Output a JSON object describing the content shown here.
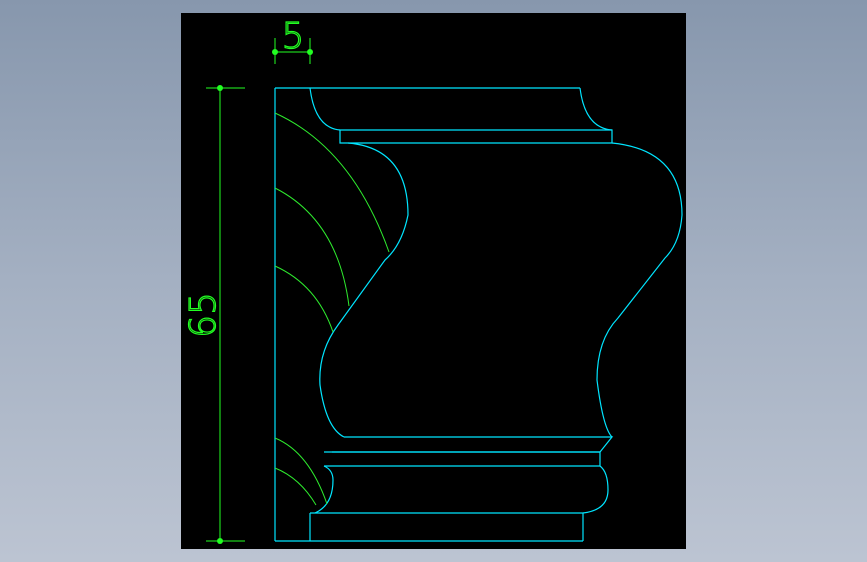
{
  "colors": {
    "background": "#8f9db1",
    "canvas": "#000000",
    "profile_line": "#00e5ff",
    "hatch_line": "#2eea2e",
    "dimension_line": "#22ff22",
    "grip_point": "#22ff22"
  },
  "dimensions": {
    "height_label": "65",
    "width_label": "5"
  }
}
